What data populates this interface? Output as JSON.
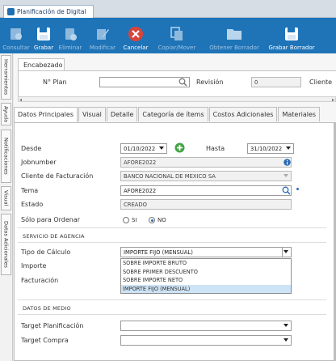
{
  "window": {
    "tab_title": "Planificación de Digital"
  },
  "toolbar": {
    "consultar": "Consultar",
    "grabar": "Grabar",
    "eliminar": "Eliminar",
    "modificar": "Modificar",
    "cancelar": "Cancelar",
    "copiar_mover": "Copiar/Mover",
    "obtener_borrador": "Obtener Borrador",
    "grabar_borrador": "Grabar Borrador"
  },
  "sidebar": [
    "Herramientas",
    "Ayuda",
    "Notificaciones",
    "Visual",
    "Datos Adicionales"
  ],
  "encabezado": {
    "tab": "Encabezado",
    "plan_label": "N° Plan",
    "plan_value": "",
    "revision_label": "Revisión",
    "revision_value": "0",
    "cliente_label": "Cliente"
  },
  "tabs": [
    "Datos Principales",
    "Visual",
    "Detalle",
    "Categoría de ítems",
    "Costos Adicionales",
    "Materiales"
  ],
  "form": {
    "desde_label": "Desde",
    "desde_value": "01/10/2022",
    "hasta_label": "Hasta",
    "hasta_value": "31/10/2022",
    "jobnumber_label": "Jobnumber",
    "jobnumber_value": "AFORE2022",
    "cliente_fact_label": "Cliente de Facturación",
    "cliente_fact_value": "BANCO NACIONAL DE MEXICO SA",
    "tema_label": "Tema",
    "tema_value": "AFORE2022",
    "estado_label": "Estado",
    "estado_value": "CREADO",
    "solo_ordenar_label": "Sólo para Ordenar",
    "si_label": "SI",
    "no_label": "NO",
    "servicio_header": "SERVICIO DE AGENCIA",
    "tipo_calculo_label": "Tipo de Cálculo",
    "tipo_calculo_value": "IMPORTE FIJO (MENSUAL)",
    "importe_label": "Importe",
    "facturacion_label": "Facturación",
    "dropdown_options": [
      "SOBRE IMPORTE BRUTO",
      "SOBRE PRIMER DESCUENTO",
      "SOBRE IMPORTE NETO",
      "IMPORTE FIJO (MENSUAL)"
    ],
    "datos_medio_header": "DATOS DE MEDIO",
    "target_plan_label": "Target Planificación",
    "target_compra_label": "Target Compra"
  },
  "colors": {
    "toolbar": "#1f74b8",
    "cancel": "#d9433a",
    "add": "#45a545"
  }
}
